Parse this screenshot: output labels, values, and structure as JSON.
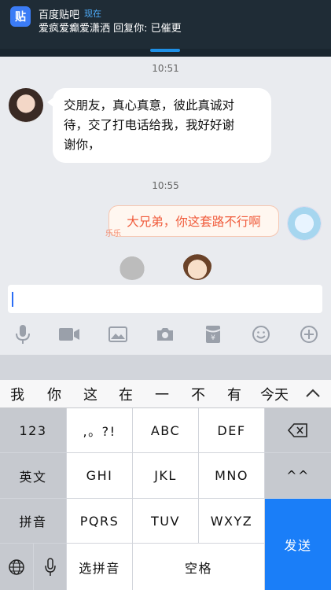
{
  "notification": {
    "app_icon_char": "贴",
    "app_name": "百度贴吧",
    "time": "现在",
    "message": "爱疯爱癫爱潇洒 回复你: 已催更"
  },
  "chat": {
    "messages": [
      {
        "timestamp": "10:51",
        "side": "left",
        "text_line1": "交朋友，真心真意，彼此真诚对",
        "text_line2": "待，交了打电话给我，我好好谢",
        "text_line3": "谢你，"
      },
      {
        "timestamp": "10:55",
        "side": "right",
        "text": "大兄弟，你这套路不行啊",
        "deco": "乐乐"
      }
    ]
  },
  "input": {
    "value": ""
  },
  "keyboard": {
    "candidates": [
      "我",
      "你",
      "这",
      "在",
      "一",
      "不",
      "有",
      "今天"
    ],
    "rows": {
      "r1": [
        "123",
        ",。?!",
        "ABC",
        "DEF"
      ],
      "r2": [
        "英文",
        "GHI",
        "JKL",
        "MNO",
        "^^"
      ],
      "r3": [
        "拼音",
        "PQRS",
        "TUV",
        "WXYZ"
      ],
      "r4": [
        "选拼音",
        "空格"
      ]
    },
    "send": "发送"
  },
  "colors": {
    "banner_bg": "#1f2c36",
    "accent_blue": "#1a7ef8",
    "bubble_red_text": "#f05a3a"
  }
}
